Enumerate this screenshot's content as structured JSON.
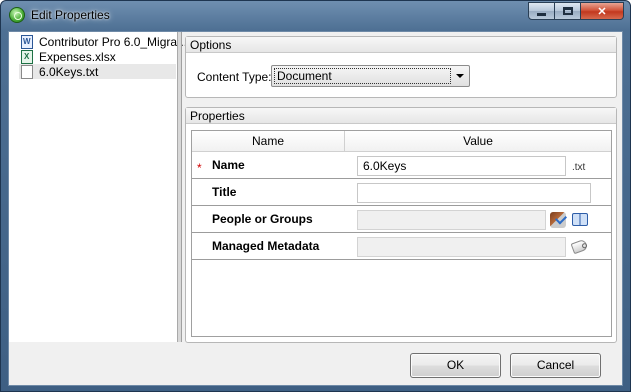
{
  "window": {
    "title": "Edit Properties",
    "icon": "green-circle-app-icon"
  },
  "file_list": {
    "items": [
      {
        "name": "Contributor Pro 6.0_Migra...",
        "icon": "word-document-icon",
        "selected": false
      },
      {
        "name": "Expenses.xlsx",
        "icon": "excel-document-icon",
        "selected": false
      },
      {
        "name": "6.0Keys.txt",
        "icon": "text-document-icon",
        "selected": true
      }
    ]
  },
  "options": {
    "header": "Options",
    "content_type_label": "Content Type:",
    "content_type_value": "Document"
  },
  "properties": {
    "header": "Properties",
    "columns": [
      "Name",
      "Value"
    ],
    "rows": [
      {
        "label": "Name",
        "required_marker": "*",
        "value": "6.0Keys",
        "suffix": ".txt"
      },
      {
        "label": "Title",
        "value": ""
      },
      {
        "label": "People or Groups",
        "value": ""
      },
      {
        "label": "Managed Metadata",
        "value": ""
      }
    ]
  },
  "buttons": {
    "ok": "OK",
    "cancel": "Cancel"
  },
  "colors": {
    "title_bar": "#4d6f93",
    "required_marker": "#d00000",
    "client_background": "#f0f0f0"
  }
}
